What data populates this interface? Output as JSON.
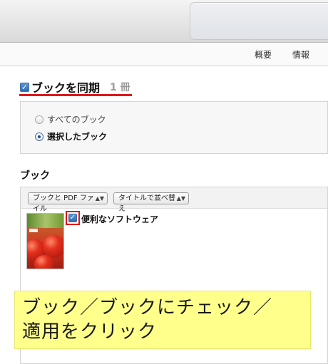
{
  "tabs": {
    "summary": "概要",
    "info": "情報"
  },
  "sync": {
    "title": "ブックを同期",
    "count": "1 冊",
    "checked": true
  },
  "radio_options": [
    {
      "label": "すべてのブック",
      "selected": false
    },
    {
      "label": "選択したブック",
      "selected": true
    }
  ],
  "books": {
    "heading": "ブック",
    "filter_type": "ブックと PDF ファイル",
    "sort_order": "タイトルで並べ替え",
    "items": [
      {
        "title": "便利なソフトウェア",
        "checked": true
      }
    ]
  },
  "callout": {
    "line1": "ブック／ブックにチェック／",
    "line2": "適用をクリック"
  },
  "colors": {
    "highlight": "#e0161a",
    "callout_bg": "#ffff8c",
    "checkbox": "#2f6db4"
  }
}
